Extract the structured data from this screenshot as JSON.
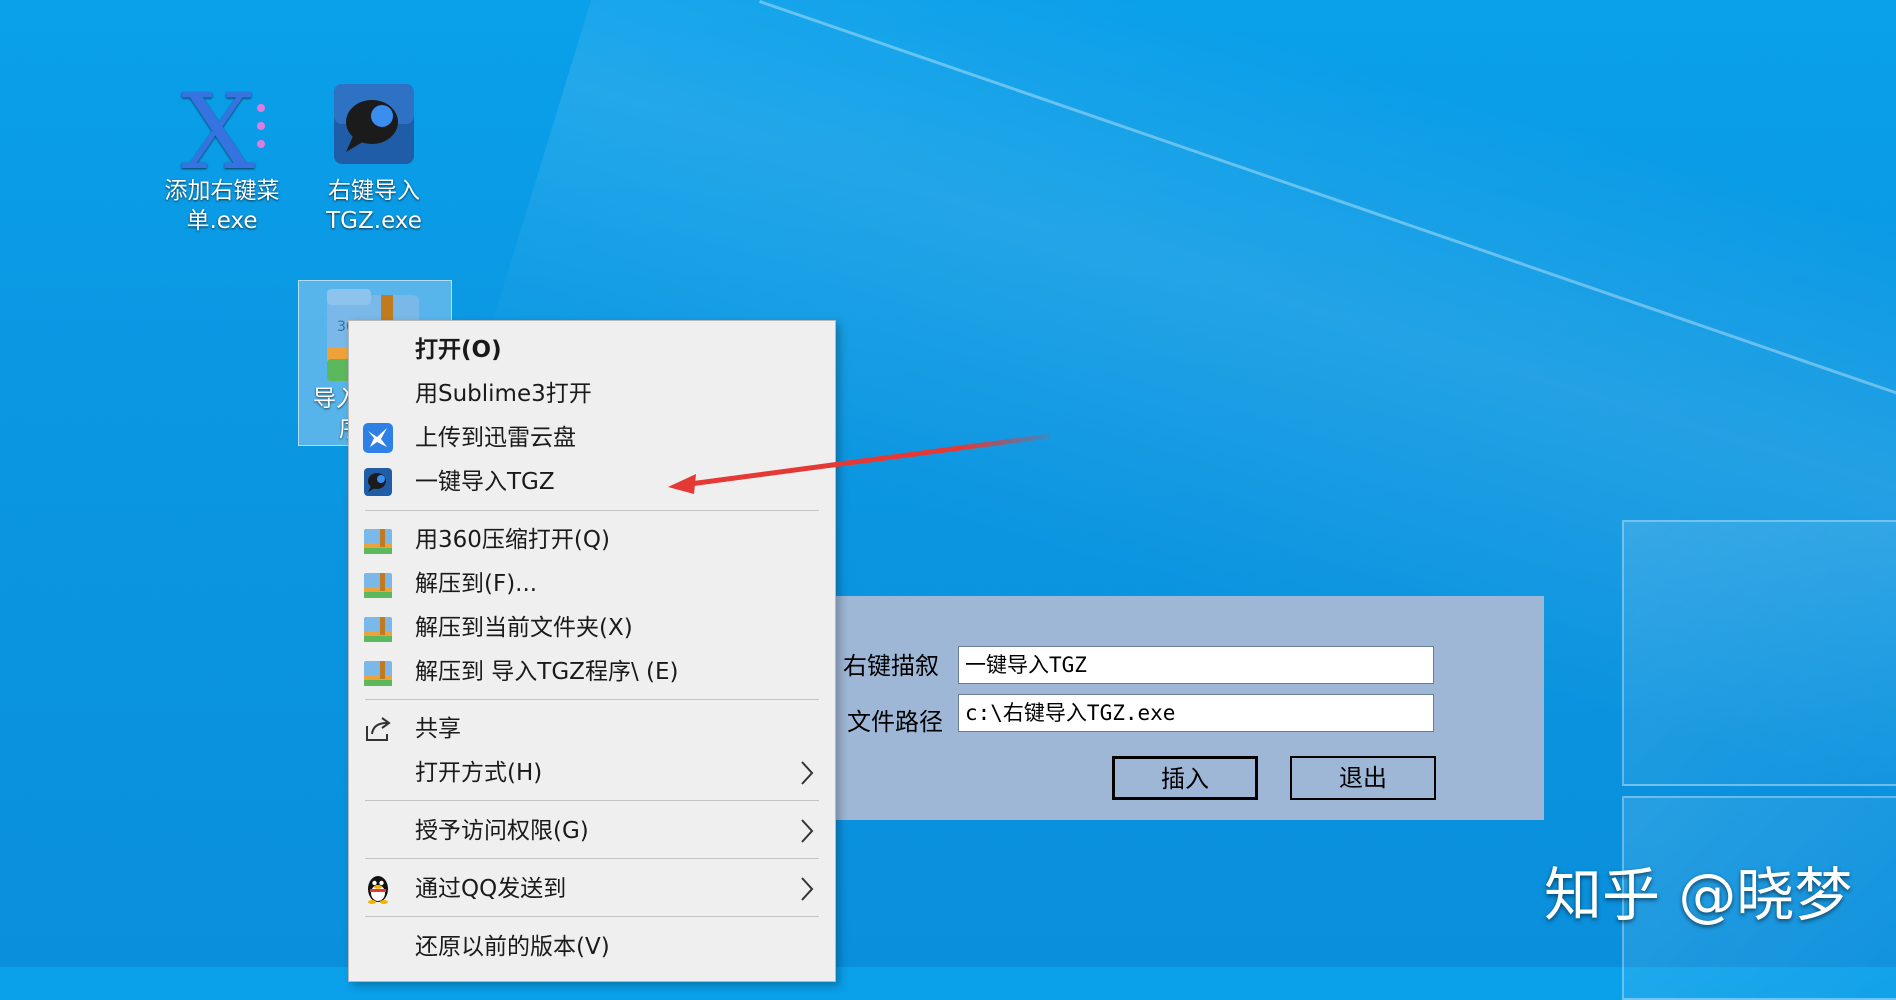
{
  "desktop": {
    "icons": [
      {
        "label_line1": "添加右键菜",
        "label_line2": "单.exe",
        "icon": "x-purple-icon"
      },
      {
        "label_line1": "右键导入",
        "label_line2": "TGZ.exe",
        "icon": "speech-bubble-icon"
      },
      {
        "label_line1": "导入",
        "label_line2": "序",
        "icon": "archive-folder-icon"
      }
    ]
  },
  "context_menu": {
    "items": [
      {
        "label": "打开(O)",
        "bold": true,
        "icon": ""
      },
      {
        "label": "用Sublime3打开",
        "icon": ""
      },
      {
        "label": "上传到迅雷云盘",
        "icon": "thunder-bird-icon"
      },
      {
        "label": "一键导入TGZ",
        "icon": "speech-bubble-icon"
      },
      {
        "label": "用360压缩打开(Q)",
        "icon": "archive-folder-icon"
      },
      {
        "label": "解压到(F)...",
        "icon": "archive-folder-icon"
      },
      {
        "label": "解压到当前文件夹(X)",
        "icon": "archive-folder-icon"
      },
      {
        "label": "解压到 导入TGZ程序\\ (E)",
        "icon": "archive-folder-icon"
      },
      {
        "label": "共享",
        "icon": "share-icon"
      },
      {
        "label": "打开方式(H)",
        "icon": "",
        "submenu": true
      },
      {
        "label": "授予访问权限(G)",
        "icon": "",
        "submenu": true
      },
      {
        "label": "通过QQ发送到",
        "icon": "qq-penguin-icon",
        "submenu": true
      },
      {
        "label": "还原以前的版本(V)",
        "icon": ""
      }
    ]
  },
  "dialog": {
    "desc_label": "右键描叙",
    "desc_value": "一键导入TGZ",
    "path_label": "文件路径",
    "path_value": "c:\\右键导入TGZ.exe",
    "insert_button": "插入",
    "exit_button": "退出"
  },
  "watermark": "知乎 @晓梦",
  "colors": {
    "desktop_bg": "#0a97e2",
    "dialog_bg": "#9eb7d6",
    "menu_bg": "#efefef",
    "annotation_arrow": "#e53935"
  }
}
